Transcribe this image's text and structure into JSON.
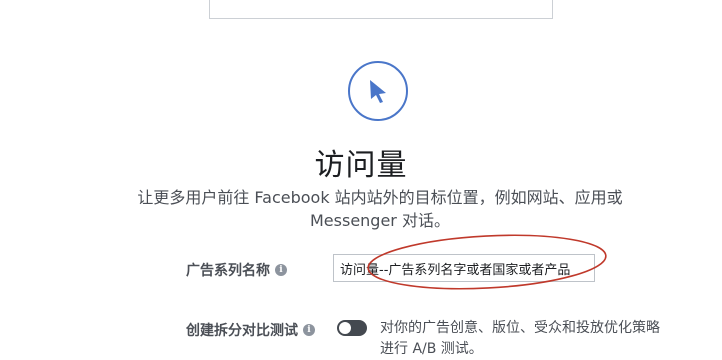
{
  "objective": {
    "icon": "cursor-arrow-icon",
    "title": "访问量",
    "description": "让更多用户前往 Facebook 站内站外的目标位置，例如网站、应用或 Messenger 对话。"
  },
  "campaign_name": {
    "label": "广告系列名称",
    "value": "访问量--广告系列名字或者国家或者产品"
  },
  "split_test": {
    "label": "创建拆分对比测试",
    "enabled": false,
    "description": "对你的广告创意、版位、受众和投放优化策略进行 A/B 测试。"
  },
  "colors": {
    "accent": "#4a76c9",
    "annotation": "#c0392b",
    "toggle": "#444950"
  }
}
